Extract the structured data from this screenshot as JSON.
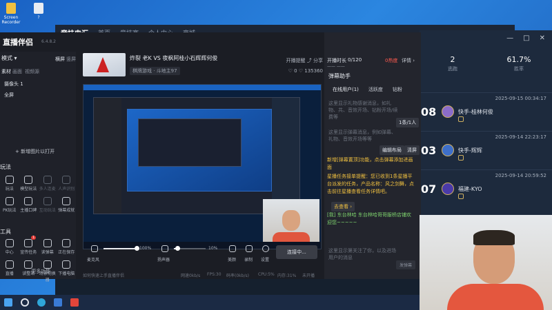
{
  "desktop": {
    "icons": [
      {
        "label": "Screen Recorder"
      },
      {
        "label": "?"
      }
    ]
  },
  "bg_app": {
    "logo": "竞技电汇",
    "nav": [
      "首页",
      "竞技赛",
      "个人中心",
      "商城"
    ]
  },
  "stats_panel": {
    "win_controls": [
      "—",
      "□",
      "✕"
    ],
    "stats": [
      {
        "value": "2",
        "label": "逃跑"
      },
      {
        "value": "61.7%",
        "label": "胜率"
      }
    ],
    "matches": [
      {
        "score": "08",
        "date": "2025-09-15 00:34:17",
        "player": "快手-桂林何俊"
      },
      {
        "score": "03",
        "date": "2025-09-14 22:23:17",
        "player": "快手-辉辉"
      },
      {
        "score": "07",
        "date": "2025-09-14 20:59:52",
        "player": "福建-KYO"
      }
    ]
  },
  "app": {
    "title": "直播伴侣",
    "version": "6.4.8.2",
    "scene_section": "模式",
    "scene_tabs": [
      "横屏",
      "竖屏"
    ],
    "source_tabs": [
      "素材",
      "画面",
      "视频源"
    ],
    "sources": [
      "摄像头 1",
      "全屏"
    ],
    "add_scene": "+ 新增图片以打开",
    "play_section": "玩法",
    "play_tools": [
      {
        "label": "玩法",
        "dim": false
      },
      {
        "label": "模型玩法",
        "dim": false
      },
      {
        "label": "多人连麦",
        "dim": true
      },
      {
        "label": "人声识别",
        "dim": true
      },
      {
        "label": "PK玩法",
        "dim": false
      },
      {
        "label": "主播口碑",
        "dim": false
      },
      {
        "label": "互动玩法",
        "dim": true
      },
      {
        "label": "弹幕成就",
        "dim": false
      }
    ],
    "tools_section": "工具",
    "tools": [
      {
        "label": "中心",
        "badge": ""
      },
      {
        "label": "宣传任务",
        "badge": "1"
      },
      {
        "label": "读弹幕",
        "badge": ""
      },
      {
        "label": "正在保存",
        "badge": ""
      },
      {
        "label": "直播",
        "badge": ""
      },
      {
        "label": "读整站",
        "badge": ""
      },
      {
        "label": "场景切换器",
        "badge": ""
      },
      {
        "label": "下播电脑",
        "badge": ""
      }
    ],
    "more_label": "更多功能"
  },
  "stream": {
    "title": "炸裂 老K VS 夜枫阿桂小石辉辉何俊",
    "category": "棋牌游戏 · 斗地主97",
    "hdr_right": "开播提醒 ⤴ 分享",
    "likes": "♡ 0   ♡ 135360"
  },
  "controls": {
    "mic_label": "麦克风",
    "mic_pct": "100%",
    "mic_level": 1.0,
    "speaker_label": "扬声器",
    "speaker_pct": "10%",
    "speaker_level": 0.1,
    "beauty_label": "美颜",
    "record_label": "录制",
    "settings_label": "设置",
    "golive_label": "连接中..."
  },
  "status": {
    "help": "如何快速上手直播伴侣",
    "net": "网速0kb/s",
    "fps": "FPS:30",
    "bitrate": "码率(0kb/s)",
    "cpu": "CPU:5%",
    "mem": "内存:31%",
    "unopened": "未开播"
  },
  "chat": {
    "live_label": "开播时长",
    "viewer_count": "0/120",
    "hot_label": "0热度",
    "detail": "详情 ›",
    "sub_label": "—— ——",
    "dm_title": "弹幕助手",
    "tabs": [
      "在线用户(1)",
      "活跃度",
      "钻粉"
    ],
    "hint1": "这里显示礼物感谢消息，如礼物、共、音效开场、钻粉开场/续费等",
    "count_badge": "1条/1人",
    "hint2": "这里显示弹幕消息，例如弹幕、礼物、音效开场等等",
    "edit_layout": "编辑布局",
    "clear": "清屏",
    "sys1": "新增[弹幕置顶]功能，点击弹幕添加进画面",
    "sys2": "星播任务接单提醒：您已收到1条星播平台派发的任务，产品名称：风之剑舞，点击前往星播查看任务详情吧。",
    "go_view": "去查看 ›",
    "user_msg": "[我] 东台林哈 东台林哈哥哥服桥店铺欢迎您~~~~~",
    "hint3": "这里显示第关注了你，以及进场用户的消息",
    "send_label": "发弹幕"
  }
}
